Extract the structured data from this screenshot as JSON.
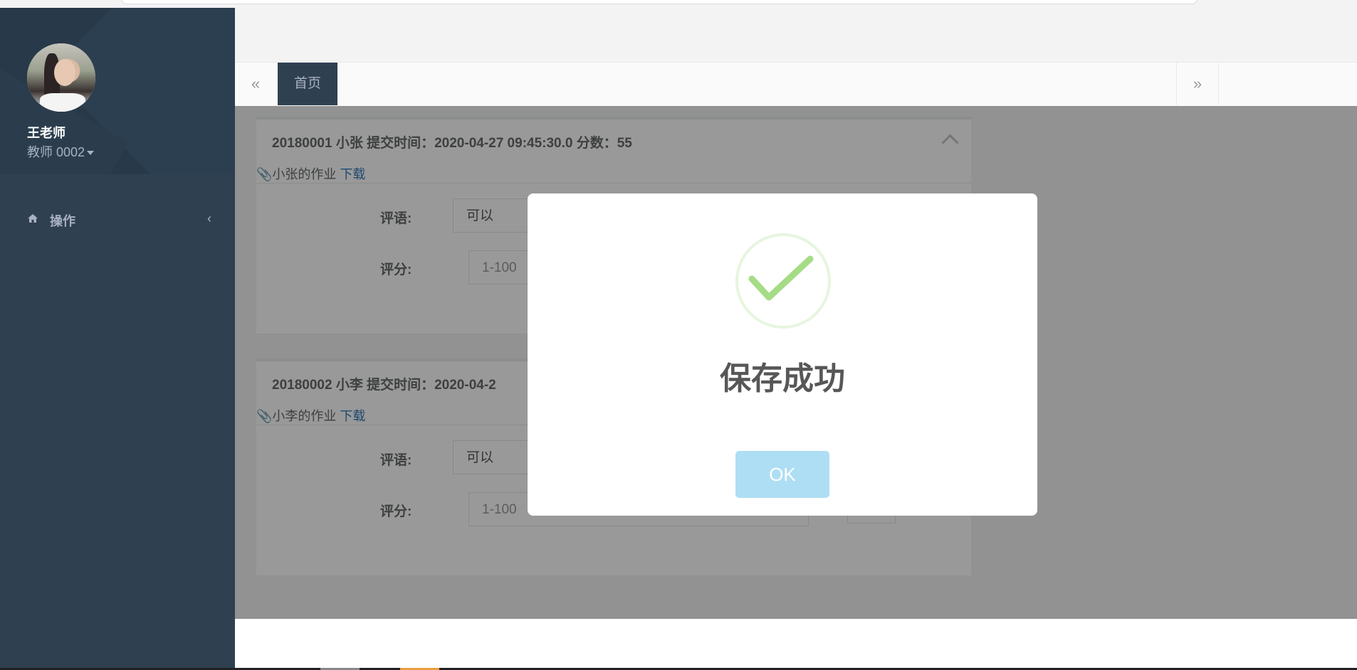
{
  "sidebar": {
    "username": "王老师",
    "role": "教师 0002",
    "nav": [
      {
        "label": "操作",
        "icon": "home-icon"
      }
    ]
  },
  "tabs": {
    "prev": "«",
    "active": "首页",
    "next": "»"
  },
  "submissions": [
    {
      "header": "20180001 小张   提交时间：2020-04-27 09:45:30.0   分数：55",
      "attachment": "小张的作业",
      "download": "下载",
      "comment_label": "评语:",
      "comment_value": "可以",
      "score_label": "评分:",
      "score_placeholder": "1-100"
    },
    {
      "header": "20180002 小李   提交时间：2020-04-2",
      "attachment": "小李的作业",
      "download": "下载",
      "comment_label": "评语:",
      "comment_value": "可以",
      "score_label": "评分:",
      "score_placeholder": "1-100"
    }
  ],
  "modal": {
    "title": "保存成功",
    "ok": "OK",
    "icon": "success-check-icon"
  },
  "colors": {
    "sidebar": "#2f4050",
    "overlay": "rgba(0,0,0,0.4)",
    "ok_button": "#aedef4",
    "check": "#a5dc86"
  }
}
